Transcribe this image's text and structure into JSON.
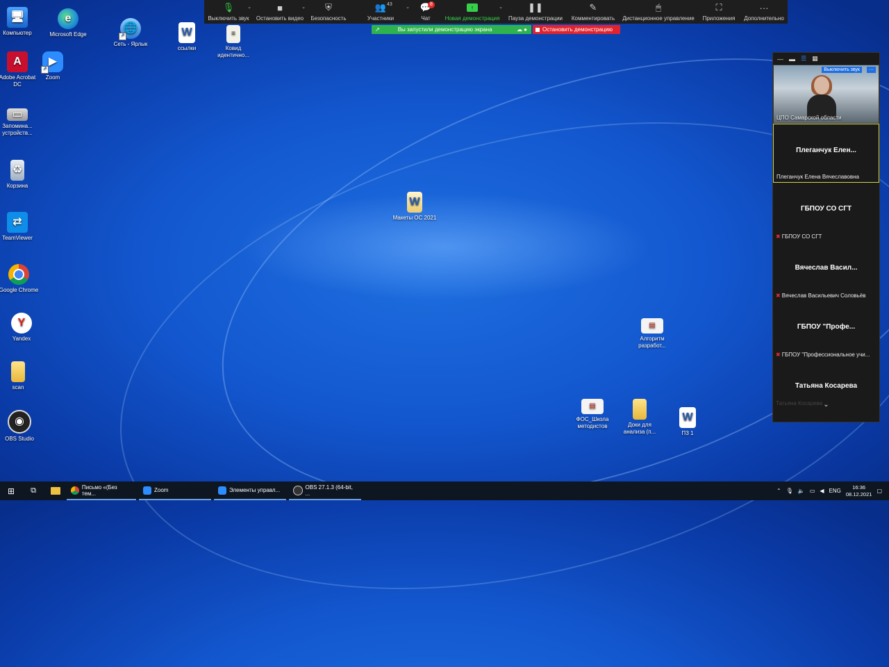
{
  "desktop_icons": [
    {
      "label": "Компьютер"
    },
    {
      "label": "Microsoft Edge"
    },
    {
      "label": "Сеть - Ярлык"
    },
    {
      "label": "ссылки"
    },
    {
      "label": "Ковид идентично..."
    },
    {
      "label": "Adobe Acrobat DC"
    },
    {
      "label": "Zoom"
    },
    {
      "label": "Запомина... устройств..."
    },
    {
      "label": "Корзина"
    },
    {
      "label": "TeamViewer"
    },
    {
      "label": "Google Chrome"
    },
    {
      "label": "Yandex"
    },
    {
      "label": "scan"
    },
    {
      "label": "OBS Studio"
    },
    {
      "label": "Макеты ОС 2021"
    },
    {
      "label": "Алгоритм разработ..."
    },
    {
      "label": "ФОС_Школа методистов"
    },
    {
      "label": "Доки для анализа (п..."
    },
    {
      "label": "ПЗ 1"
    }
  ],
  "zoom_toolbar": {
    "mute": "Выключить звук",
    "video": "Остановить видео",
    "security": "Безопасность",
    "participants": "Участники",
    "participants_count": "43",
    "chat": "Чат",
    "chat_badge": "8",
    "new_share": "Новая демонстрация",
    "pause_share": "Пауза демонстрации",
    "annotate": "Комментировать",
    "remote_control": "Дистанционное управление",
    "apps": "Приложения",
    "more": "Дополнительно"
  },
  "share_banner": {
    "text": "Вы запустили демонстрацию экрана",
    "stop": "Остановить демонстрацию"
  },
  "panel": {
    "mute_overlay": "Выключить звук",
    "more_overlay": "···",
    "tiles": [
      {
        "big": "",
        "small": "ЦПО Самарской области"
      },
      {
        "big": "Плеганчук Елен...",
        "small": "Плеганчук Елена Вячеславовна"
      },
      {
        "big": "ГБПОУ СО СГТ",
        "small": "ГБПОУ СО СГТ"
      },
      {
        "big": "Вячеслав Васил...",
        "small": "Вячеслав Васильевич Соловьёв"
      },
      {
        "big": "ГБПОУ  \"Профе...",
        "small": "ГБПОУ \"Профессиональное учи..."
      },
      {
        "big": "Татьяна Косарева",
        "small": "Татьяна Косарева"
      }
    ]
  },
  "taskbar": {
    "apps": [
      {
        "label": "Письмо «(Без тем..."
      },
      {
        "label": "Zoom"
      },
      {
        "label": "Элементы управл..."
      },
      {
        "label": "OBS 27.1.3 (64-bit, ..."
      }
    ],
    "lang": "ENG",
    "time": "16:36",
    "date": "08.12.2021"
  },
  "colors": {
    "desktop": "#1357cf",
    "toolbar": "#1e1e1e",
    "share_green": "#2fb34f",
    "stop_red": "#e0242f",
    "speaker_border": "#d8d24a"
  }
}
